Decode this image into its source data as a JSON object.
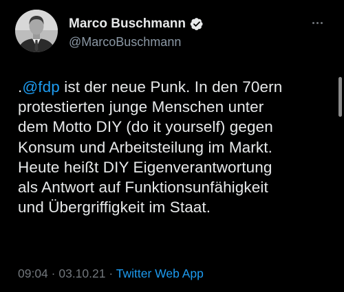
{
  "author": {
    "display_name": "Marco Buschmann",
    "handle": "@MarcoBuschmann",
    "verified": true
  },
  "tweet": {
    "lines": [
      {
        "prefix": ".",
        "mention": "@fdp",
        "rest": " ist der neue Punk. In den 70ern"
      },
      "protestierten junge Menschen unter",
      "dem Motto DIY (do it yourself) gegen",
      "Konsum und Arbeitsteilung im Markt.",
      "Heute heißt DIY Eigenverantwortung",
      "als Antwort auf Funktionsunfähigkeit",
      "und Übergriffigkeit im Staat."
    ]
  },
  "meta": {
    "time": "09:04",
    "separator": " · ",
    "date": "03.10.21",
    "source": "Twitter Web App"
  },
  "icons": {
    "verified": "verified-badge-icon",
    "more": "more-options-icon"
  },
  "colors": {
    "background": "#000000",
    "text": "#e7e9ea",
    "secondary": "#71767b",
    "accent": "#1d9bf0"
  }
}
